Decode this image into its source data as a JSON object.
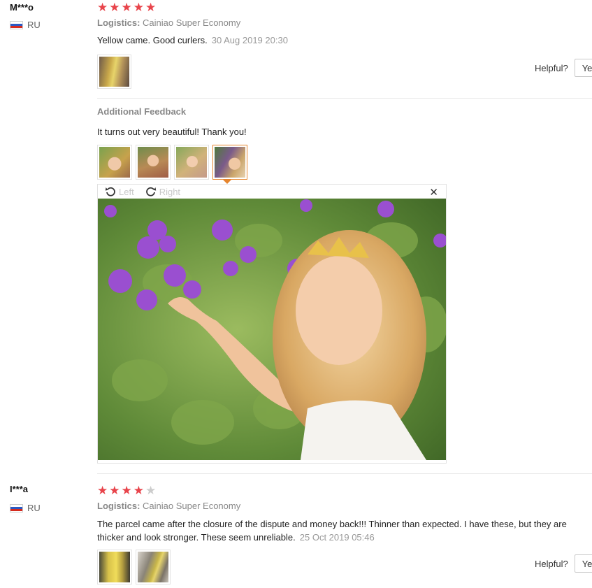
{
  "colors": {
    "star_on": "#e8444b",
    "star_off": "#cccccc",
    "selected_border": "#e6852d"
  },
  "reviews": [
    {
      "user": "M***o",
      "country": "RU",
      "rating": 5,
      "logistics_label": "Logistics:",
      "logistics_value": "Cainiao Super Economy",
      "text": "Yellow came. Good curlers.",
      "date": "30 Aug 2019 20:30",
      "helpful_label": "Helpful?",
      "yes_label": "Yes",
      "additional": {
        "title": "Additional Feedback",
        "text": "It turns out very beautiful! Thank you!",
        "viewer": {
          "rotate_left": "Left",
          "rotate_right": "Right",
          "close_icon": "close-icon"
        }
      }
    },
    {
      "user": "I***a",
      "country": "RU",
      "rating": 4,
      "logistics_label": "Logistics:",
      "logistics_value": "Cainiao Super Economy",
      "text_line1": "The parcel came after the closure of the dispute and money back!!! Thinner than expected. I have these, but they are",
      "text_line2": "thicker and look stronger. These seem unreliable.",
      "date": "25 Oct 2019 05:46",
      "helpful_label": "Helpful?",
      "yes_label": "Yes"
    }
  ]
}
